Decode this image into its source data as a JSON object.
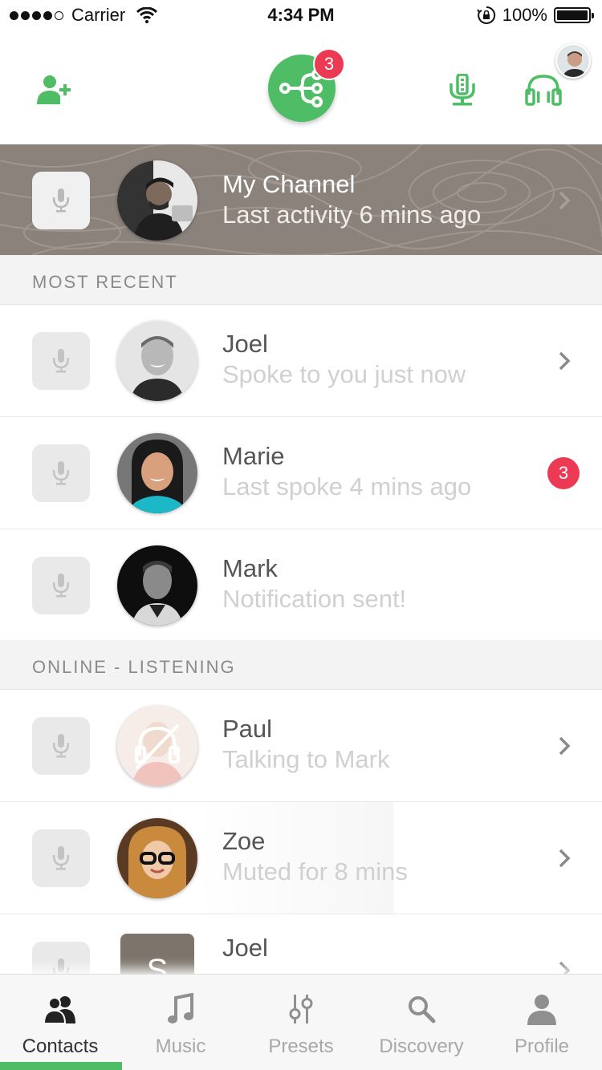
{
  "status_bar": {
    "carrier": "Carrier",
    "time": "4:34 PM",
    "battery": "100%"
  },
  "toolbar": {
    "share_badge": "3"
  },
  "channel": {
    "title": "My Channel",
    "subtitle": "Last activity 6 mins ago"
  },
  "sections": {
    "recent": "MOST RECENT",
    "online": "ONLINE - LISTENING"
  },
  "contacts": [
    {
      "name": "Joel",
      "status": "Spoke to you just now"
    },
    {
      "name": "Marie",
      "status": "Last spoke 4 mins ago",
      "badge": "3"
    },
    {
      "name": "Mark",
      "status": "Notification sent!"
    },
    {
      "name": "Paul",
      "status": "Talking to Mark"
    },
    {
      "name": "Zoe",
      "status": "Muted for 8 mins"
    },
    {
      "name": "Joel",
      "initial": "S"
    }
  ],
  "tabs": [
    {
      "label": "Contacts",
      "icon": "contacts-icon"
    },
    {
      "label": "Music",
      "icon": "music-note-icon"
    },
    {
      "label": "Presets",
      "icon": "sliders-icon"
    },
    {
      "label": "Discovery",
      "icon": "search-icon"
    },
    {
      "label": "Profile",
      "icon": "person-icon"
    }
  ],
  "colors": {
    "accent_green": "#4fbd66",
    "badge_red": "#ec3a55",
    "channel_bg": "#8b837b"
  }
}
